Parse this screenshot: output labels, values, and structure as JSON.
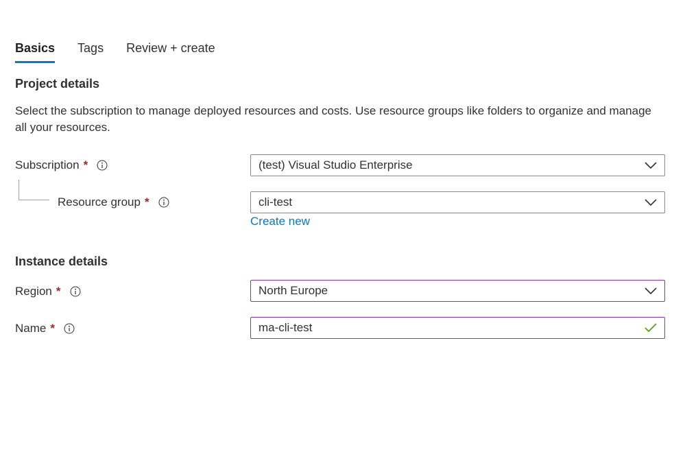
{
  "tabs": [
    {
      "label": "Basics",
      "active": true
    },
    {
      "label": "Tags",
      "active": false
    },
    {
      "label": "Review + create",
      "active": false
    }
  ],
  "project": {
    "title": "Project details",
    "description": "Select the subscription to manage deployed resources and costs. Use resource groups like folders to organize and manage all your resources.",
    "subscription": {
      "label": "Subscription",
      "required": "*",
      "value": "(test) Visual Studio Enterprise"
    },
    "resource_group": {
      "label": "Resource group",
      "required": "*",
      "value": "cli-test",
      "create_new_label": "Create new"
    }
  },
  "instance": {
    "title": "Instance details",
    "region": {
      "label": "Region",
      "required": "*",
      "value": "North Europe"
    },
    "name": {
      "label": "Name",
      "required": "*",
      "value": "ma-cli-test"
    }
  },
  "icons": {
    "info": "info-icon",
    "dropdown": "chevron-down-icon",
    "valid": "checkmark-icon"
  },
  "colors": {
    "accent": "#0078d4",
    "required": "#a4262c",
    "focus_border": "#8a2fc9",
    "valid_check": "#57a300"
  }
}
